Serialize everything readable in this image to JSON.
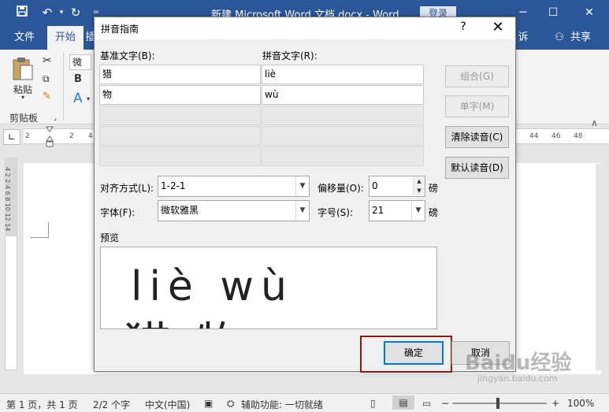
{
  "window": {
    "title": "新建 Microsoft Word 文档.docx  -  Word",
    "login": "登录"
  },
  "ribbon": {
    "tabs": [
      {
        "label": "文件"
      },
      {
        "label": "开始"
      },
      {
        "label": "插"
      }
    ],
    "right_tabs": {
      "tell": "诉我",
      "share": "共享"
    },
    "paste_label": "粘贴",
    "clipboard_group": "剪贴板",
    "font_box": "微软",
    "bold_label": "B",
    "font_color_label": "A"
  },
  "ruler": {
    "ticks_left": [
      "2",
      "2",
      "4"
    ],
    "ticks_right": [
      "44",
      "46",
      "48"
    ],
    "vertical_ticks": [
      "4",
      "2",
      "2",
      "4",
      "6",
      "8",
      "10",
      "12",
      "14"
    ]
  },
  "dialog": {
    "title": "拼音指南",
    "help": "?",
    "close": "✕",
    "base_text_label": "基准文字(B):",
    "ruby_text_label": "拼音文字(R):",
    "rows": [
      {
        "base": "猎",
        "ruby": "liè"
      },
      {
        "base": "物",
        "ruby": "wù"
      },
      {
        "base": "",
        "ruby": ""
      },
      {
        "base": "",
        "ruby": ""
      },
      {
        "base": "",
        "ruby": ""
      }
    ],
    "buttons": {
      "group": "组合(G)",
      "mono": "单字(M)",
      "clear": "清除读音(C)",
      "default": "默认读音(D)",
      "ok": "确定",
      "cancel": "取消"
    },
    "alignment_label": "对齐方式(L):",
    "alignment_value": "1-2-1",
    "offset_label": "偏移量(O):",
    "offset_value": "0",
    "offset_unit": "磅",
    "font_label": "字体(F):",
    "font_value": "微软雅黑",
    "size_label": "字号(S):",
    "size_value": "21",
    "size_unit": "磅",
    "preview_label": "预览",
    "preview_pinyin": "liè    wù",
    "preview_base": "猎物"
  },
  "statusbar": {
    "page": "第 1 页，共 1 页",
    "words": "2/2 个字",
    "language": "中文(中国)",
    "accessibility": "辅助功能: 一切就绪",
    "zoom": "100%"
  },
  "watermark": {
    "brand": "Baidu经验",
    "url": "jingyan.baidu.com"
  },
  "colors": {
    "accent": "#2b579a",
    "highlight_frame": "#8b1a1a"
  }
}
